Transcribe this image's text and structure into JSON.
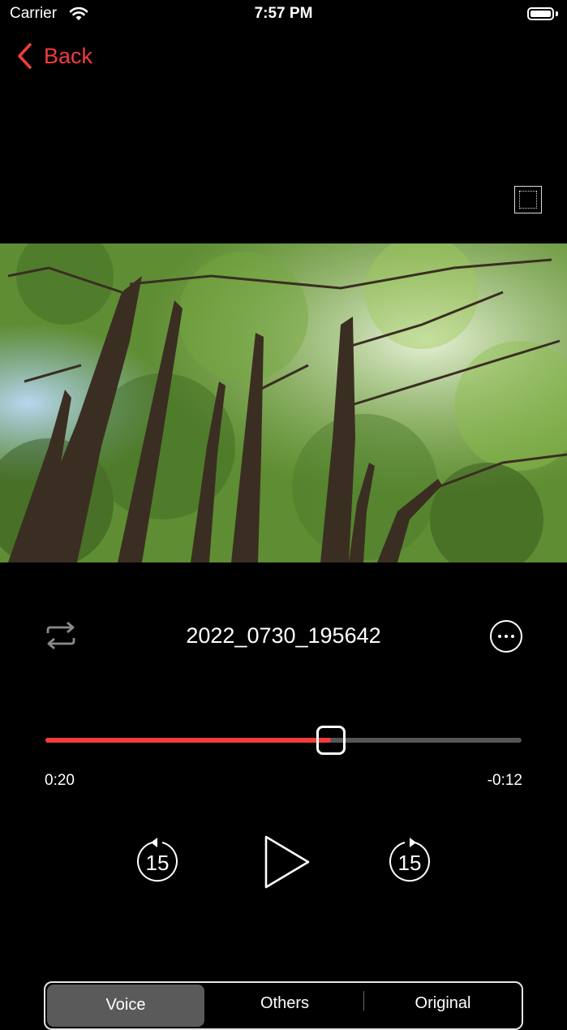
{
  "status_bar": {
    "carrier": "Carrier",
    "time": "7:57 PM"
  },
  "nav": {
    "back_label": "Back",
    "accent_color": "#f23c3c"
  },
  "player": {
    "title": "2022_0730_195642",
    "elapsed": "0:20",
    "remaining": "-0:12",
    "progress": 0.6,
    "skip_back_seconds": "15",
    "skip_forward_seconds": "15",
    "video_icon": "forest-video-thumbnail"
  },
  "segmented": {
    "items": [
      "Voice",
      "Others",
      "Original"
    ],
    "selected": "Voice"
  }
}
